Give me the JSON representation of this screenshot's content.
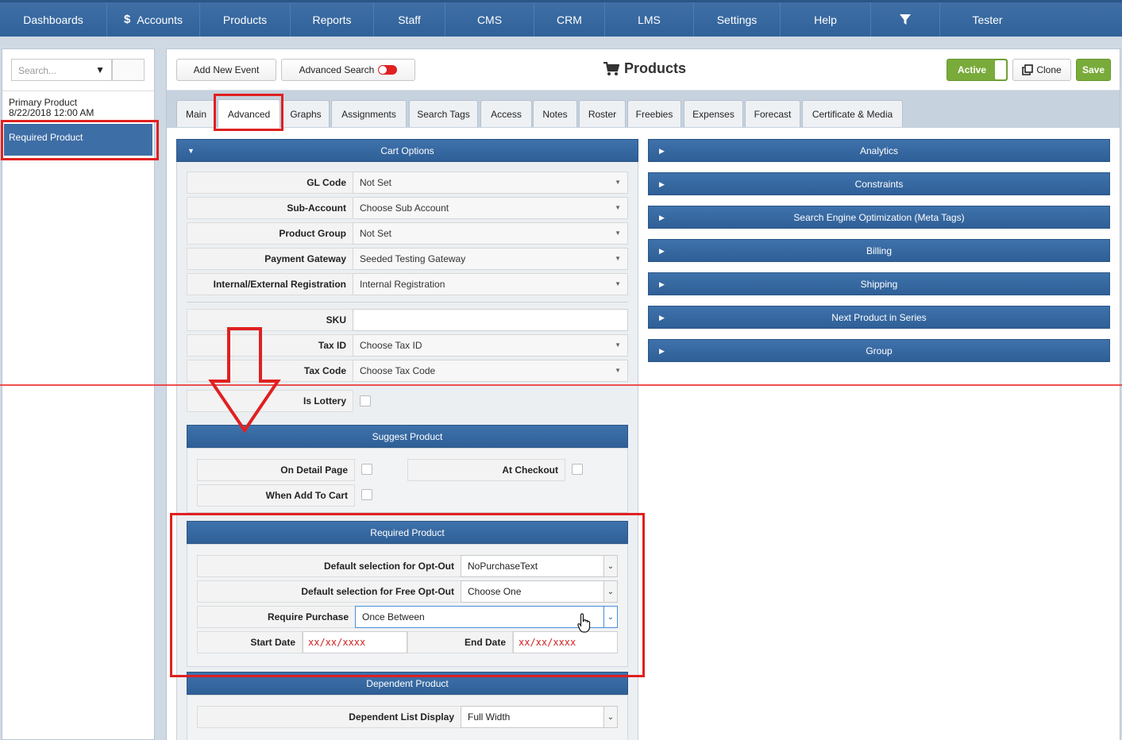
{
  "nav": {
    "items": [
      {
        "label": "Dashboards"
      },
      {
        "label": "Accounts",
        "prefix": "$"
      },
      {
        "label": "Products"
      },
      {
        "label": "Reports"
      },
      {
        "label": "Staff"
      },
      {
        "label": "CMS"
      },
      {
        "label": "CRM"
      },
      {
        "label": "LMS"
      },
      {
        "label": "Settings"
      },
      {
        "label": "Help"
      },
      {
        "label": ""
      },
      {
        "label": "Tester"
      }
    ],
    "filter_icon": "filter-icon"
  },
  "left": {
    "search_placeholder": "Search...",
    "item1_name": "Primary Product",
    "item1_date": "8/22/2018 12:00 AM",
    "selected_item": "Required Product"
  },
  "toolbar": {
    "add_event": "Add New Event",
    "advanced_search": "Advanced Search",
    "title": "Products",
    "active": "Active",
    "clone": "Clone",
    "save": "Save"
  },
  "tabs": [
    "Main",
    "Advanced",
    "Graphs",
    "Assignments",
    "Search Tags",
    "Access",
    "Notes",
    "Roster",
    "Freebies",
    "Expenses",
    "Forecast",
    "Certificate & Media"
  ],
  "cart": {
    "title": "Cart Options",
    "fields": [
      {
        "label": "GL Code",
        "value": "Not Set"
      },
      {
        "label": "Sub-Account",
        "value": "Choose Sub Account"
      },
      {
        "label": "Product Group",
        "value": "Not Set"
      },
      {
        "label": "Payment Gateway",
        "value": "Seeded Testing Gateway"
      },
      {
        "label": "Internal/External Registration",
        "value": "Internal Registration"
      }
    ],
    "sku_label": "SKU",
    "sku_value": "",
    "tax_id_label": "Tax ID",
    "tax_id_value": "Choose Tax ID",
    "tax_code_label": "Tax Code",
    "tax_code_value": "Choose Tax Code",
    "lottery_label": "Is Lottery"
  },
  "suggest": {
    "title": "Suggest Product",
    "on_detail": "On Detail Page",
    "at_checkout": "At Checkout",
    "when_add": "When Add To Cart"
  },
  "required": {
    "title": "Required Product",
    "optout_label": "Default selection for Opt-Out",
    "optout_value": "NoPurchaseText",
    "free_optout_label": "Default selection for Free Opt-Out",
    "free_optout_value": "Choose One",
    "require_label": "Require Purchase",
    "require_value": "Once Between",
    "start_label": "Start Date",
    "start_value": "xx/xx/xxxx",
    "end_label": "End Date",
    "end_value": "xx/xx/xxxx"
  },
  "dependent": {
    "title": "Dependent Product",
    "list_label": "Dependent List Display",
    "list_value": "Full Width"
  },
  "right_sections": [
    "Analytics",
    "Constraints",
    "Search Engine Optimization (Meta Tags)",
    "Billing",
    "Shipping",
    "Next Product in Series",
    "Group"
  ],
  "colors": {
    "accent": "#3e6ea6",
    "save": "#79ab3a",
    "highlight": "#e02020"
  }
}
